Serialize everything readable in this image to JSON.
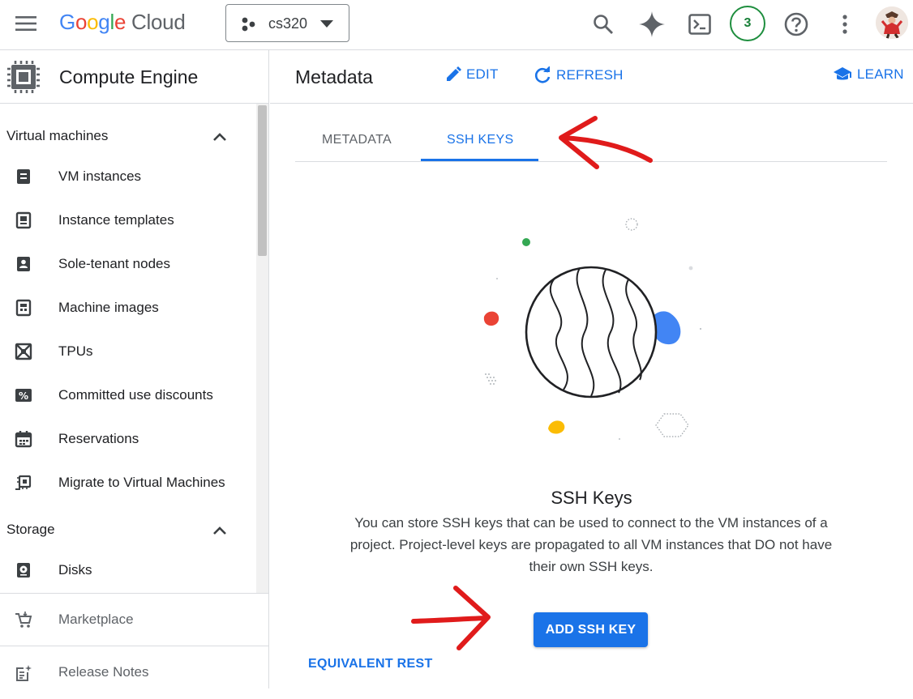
{
  "topbar": {
    "logo_google": "Google",
    "logo_cloud": "Cloud",
    "project_name": "cs320",
    "notification_count": "3"
  },
  "sidebar": {
    "product": "Compute Engine",
    "sections": [
      {
        "label": "Virtual machines"
      },
      {
        "label": "Storage"
      }
    ],
    "items": [
      {
        "label": "VM instances",
        "icon": "vm-instances-icon"
      },
      {
        "label": "Instance templates",
        "icon": "instance-templates-icon"
      },
      {
        "label": "Sole-tenant nodes",
        "icon": "sole-tenant-icon"
      },
      {
        "label": "Machine images",
        "icon": "machine-images-icon"
      },
      {
        "label": "TPUs",
        "icon": "tpu-icon"
      },
      {
        "label": "Committed use discounts",
        "icon": "percent-icon"
      },
      {
        "label": "Reservations",
        "icon": "calendar-icon"
      },
      {
        "label": "Migrate to Virtual Machines",
        "icon": "migrate-icon"
      },
      {
        "label": "Disks",
        "icon": "disk-icon"
      }
    ],
    "marketplace": "Marketplace",
    "release_notes": "Release Notes"
  },
  "main": {
    "title": "Metadata",
    "edit_label": "EDIT",
    "refresh_label": "REFRESH",
    "learn_label": "LEARN",
    "tabs": [
      {
        "label": "METADATA",
        "active": false
      },
      {
        "label": "SSH KEYS",
        "active": true
      }
    ],
    "empty_title": "SSH Keys",
    "empty_description": "You can store SSH keys that can be used to connect to the VM instances of a project. Project-level keys are propagated to all VM instances that DO not have their own SSH keys.",
    "add_button": "ADD SSH KEY",
    "equivalent_rest": "EQUIVALENT REST"
  },
  "colors": {
    "accent": "#1a73e8",
    "annotation": "#e01b1b",
    "google_blue": "#4285f4",
    "google_red": "#ea4335",
    "google_yellow": "#fbbc04",
    "google_green": "#34a853"
  }
}
